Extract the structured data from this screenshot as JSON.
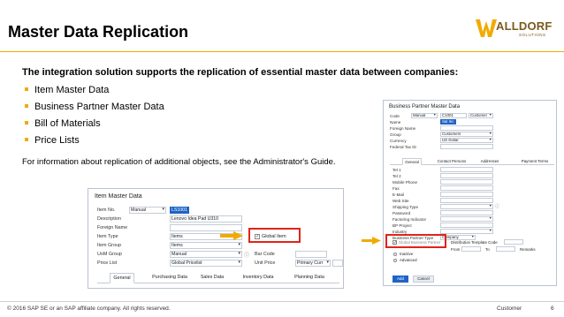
{
  "slide": {
    "title": "Master Data Replication",
    "logo": {
      "brand": "ALLDORF",
      "sub": "SOLUTIONS"
    },
    "intro": "The integration solution supports the replication of essential master data between companies:",
    "bullets": [
      "Item Master Data",
      "Business Partner Master Data",
      "Bill of Materials",
      "Price Lists"
    ],
    "note": "For information about replication of additional objects, see the Administrator's Guide.",
    "accent_color": "#f0ab00",
    "highlight_color": "#e2231a"
  },
  "item_master": {
    "title": "Item Master Data",
    "fields": {
      "item_no_label": "Item No.",
      "item_no_series": "Manual",
      "item_no_value": "LS1001",
      "description_label": "Description",
      "description_value": "Lenovo Idea Pad U310",
      "foreign_name_label": "Foreign Name",
      "item_type_label": "Item Type",
      "item_type_value": "Items",
      "item_group_label": "Item Group",
      "item_group_value": "Items",
      "uom_group_label": "UoM Group",
      "uom_group_value": "Manual",
      "price_list_label": "Price List",
      "price_list_value": "Global Pricelist",
      "global_item_label": "Global Item",
      "bar_code_label": "Bar Code",
      "unit_price_label": "Unit Price",
      "unit_price_value": "Primary Curr"
    },
    "tabs": [
      "General",
      "Purchasing Data",
      "Sales Data",
      "Inventory Data",
      "Planning Data"
    ]
  },
  "bp_master": {
    "title": "Business Partner Master Data",
    "header": {
      "code_label": "Code",
      "code_series": "Manual",
      "code_value": "C1001",
      "type_value": "Customer",
      "name_label": "Name",
      "name_value": "Sal Inc",
      "foreign_name_label": "Foreign Name",
      "group_label": "Group",
      "group_value": "Customers",
      "currency_label": "Currency",
      "currency_value": "US Dollar",
      "tax_id_label": "Federal Tax ID"
    },
    "tabs": [
      "General",
      "Contact Persons",
      "Addresses",
      "Payment Terms"
    ],
    "general_fields": [
      "Tel 1",
      "Tel 2",
      "Mobile Phone",
      "Fax",
      "E-Mail",
      "Web Site",
      "Shipping Type",
      "Password",
      "Factoring Indicator",
      "BP Project",
      "Industry",
      "Business Partner Type"
    ],
    "bp_type_value": "Company",
    "global_bp_label": "Global Business Partner",
    "dist_template_label": "Distribution Template Code",
    "from_label": "From",
    "to_label": "To",
    "remarks_label": "Remarks",
    "radio_inactive": "Inactive",
    "radio_advanced": "Advanced",
    "add_button": "Add",
    "cancel_button": "Cancel"
  },
  "footer": {
    "copyright": "© 2016 SAP SE or an SAP affiliate company. All rights reserved.",
    "audience": "Customer",
    "page": "6"
  }
}
